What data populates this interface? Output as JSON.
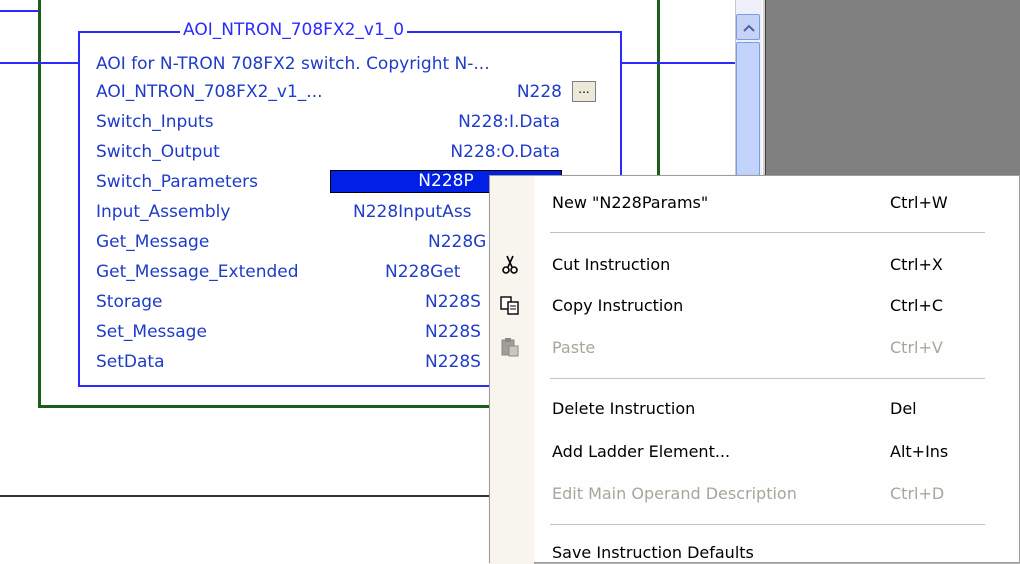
{
  "aoi": {
    "title": "AOI_NTRON_708FX2_v1_0",
    "description": "AOI for N-TRON 708FX2 switch. Copyright N-...",
    "instance_name": "AOI_NTRON_708FX2_v1_...",
    "instance_value": "N228",
    "ellipsis_button": "...",
    "params": [
      {
        "name": "Switch_Inputs",
        "value": "N228:I.Data"
      },
      {
        "name": "Switch_Output",
        "value": "N228:O.Data"
      },
      {
        "name": "Switch_Parameters",
        "value": "N228P"
      },
      {
        "name": "Input_Assembly",
        "value": "N228InputAss"
      },
      {
        "name": "Get_Message",
        "value": "N228G"
      },
      {
        "name": "Get_Message_Extended",
        "value": "N228Get"
      },
      {
        "name": "Storage",
        "value": "N228S"
      },
      {
        "name": "Set_Message",
        "value": "N228S"
      },
      {
        "name": "SetData",
        "value": "N228S"
      }
    ]
  },
  "context_menu": {
    "new_item": {
      "label": "New \"N228Params\"",
      "shortcut": "Ctrl+W"
    },
    "cut_item": {
      "label": "Cut Instruction",
      "shortcut": "Ctrl+X",
      "icon": "scissors-icon"
    },
    "copy_item": {
      "label": "Copy Instruction",
      "shortcut": "Ctrl+C",
      "icon": "copy-icon"
    },
    "paste_item": {
      "label": "Paste",
      "shortcut": "Ctrl+V",
      "icon": "paste-icon"
    },
    "delete_item": {
      "label": "Delete Instruction",
      "shortcut": "Del"
    },
    "add_item": {
      "label": "Add Ladder Element...",
      "shortcut": "Alt+Ins"
    },
    "edit_desc_item": {
      "label": "Edit Main Operand Description",
      "shortcut": "Ctrl+D"
    },
    "save_defaults_item": {
      "label": "Save Instruction Defaults"
    }
  },
  "colors": {
    "rung_wire": "#2b2bff",
    "aoi_border": "#2b2bff",
    "green_border": "#1b5e1b",
    "selection": "#0020e8",
    "gray_panel": "#808080"
  }
}
